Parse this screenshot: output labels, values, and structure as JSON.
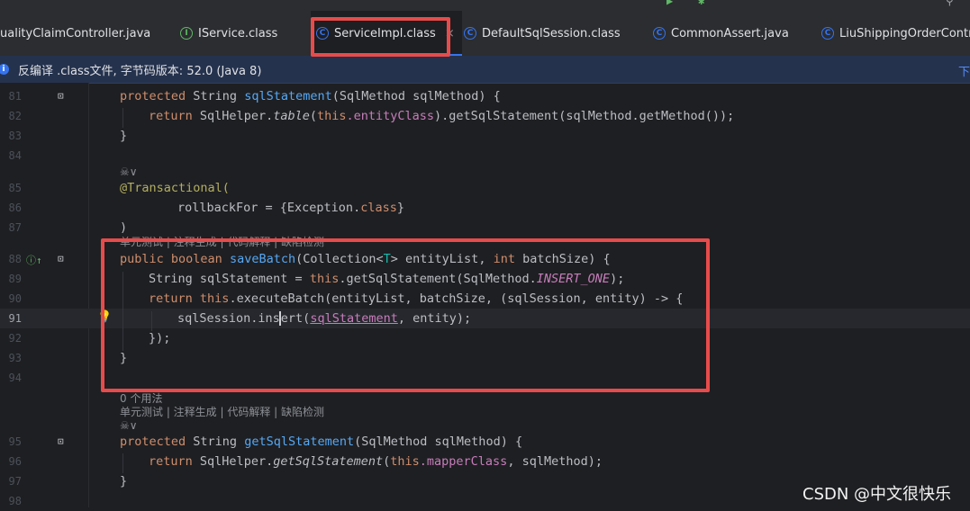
{
  "tabs": [
    {
      "label": "ualityClaimController.java",
      "icon": "java-file-icon"
    },
    {
      "label": "IService.class",
      "icon": "interface-class-icon"
    },
    {
      "label": "ServiceImpl.class",
      "icon": "class-icon",
      "active": true,
      "close": "×"
    },
    {
      "label": "DefaultSqlSession.class",
      "icon": "class-icon"
    },
    {
      "label": "CommonAssert.java",
      "icon": "class-icon"
    },
    {
      "label": "LiuShippingOrderContr",
      "icon": "class-icon"
    }
  ],
  "notice": {
    "icon": "info-icon",
    "text": "反编译 .class文件, 字节码版本: 52.0 (Java 8)",
    "link": "下"
  },
  "line_numbers": [
    "81",
    "82",
    "83",
    "84",
    "85",
    "86",
    "87",
    "88",
    "89",
    "90",
    "91",
    "92",
    "93",
    "94",
    "95",
    "96",
    "97",
    "98"
  ],
  "current_line": "91",
  "code": {
    "l81": {
      "kw": "protected",
      "type": "String",
      "name": "sqlStatement",
      "params": "(SqlMethod sqlMethod) {"
    },
    "l82": {
      "kw": "return",
      "cls": "SqlHelper.",
      "method": "table",
      "open": "(",
      "this": "this",
      "field": ".entityClass",
      "rest": ").getSqlStatement(sqlMethod.getMethod());"
    },
    "l83": "}",
    "l85": "@Transactional(",
    "l86": {
      "prefix": "rollbackFor = {Exception.",
      "kw": "class",
      "suffix": "}"
    },
    "l87": ")",
    "l88": {
      "mods": "public boolean",
      "name": "saveBatch",
      "p1": "(Collection<",
      "T": "T",
      "p2": "> entityList, ",
      "int": "int",
      "p3": " batchSize) {"
    },
    "l89": {
      "p1": "String sqlStatement = ",
      "this": "this",
      "p2": ".getSqlStatement(SqlMethod.",
      "const": "INSERT_ONE",
      "p3": ");"
    },
    "l90": {
      "ret": "return",
      "this": "this",
      "p1": ".executeBatch(entityList, batchSize, (sqlSession, entity) -> {"
    },
    "l91": {
      "p1": "sqlSession.ins",
      "p2": "ert(",
      "u": "sqlStatement",
      "p3": ", entity);"
    },
    "l92": "});",
    "l93": "}",
    "l95": {
      "kw": "protected",
      "type": "String",
      "name": "getSqlStatement",
      "params": "(SqlMethod sqlMethod) {"
    },
    "l96": {
      "kw": "return",
      "cls": "SqlHelper.",
      "method": "getSqlStatement",
      "open": "(",
      "this": "this",
      "field": ".mapperClass",
      "rest": ", sqlMethod);"
    },
    "l97": "}"
  },
  "hints": {
    "authors_1": "☠∨",
    "actions_1": "单元测试 | 注释生成 | 代码解释 | 缺陷检测",
    "usages": "0 个用法",
    "actions_2": "单元测试 | 注释生成 | 代码解释 | 缺陷检测",
    "authors_2": "☠∨"
  },
  "watermark": "CSDN @中文很快乐",
  "colors": {
    "highlight_box": "#e84b4b",
    "accent": "#3574f0"
  }
}
